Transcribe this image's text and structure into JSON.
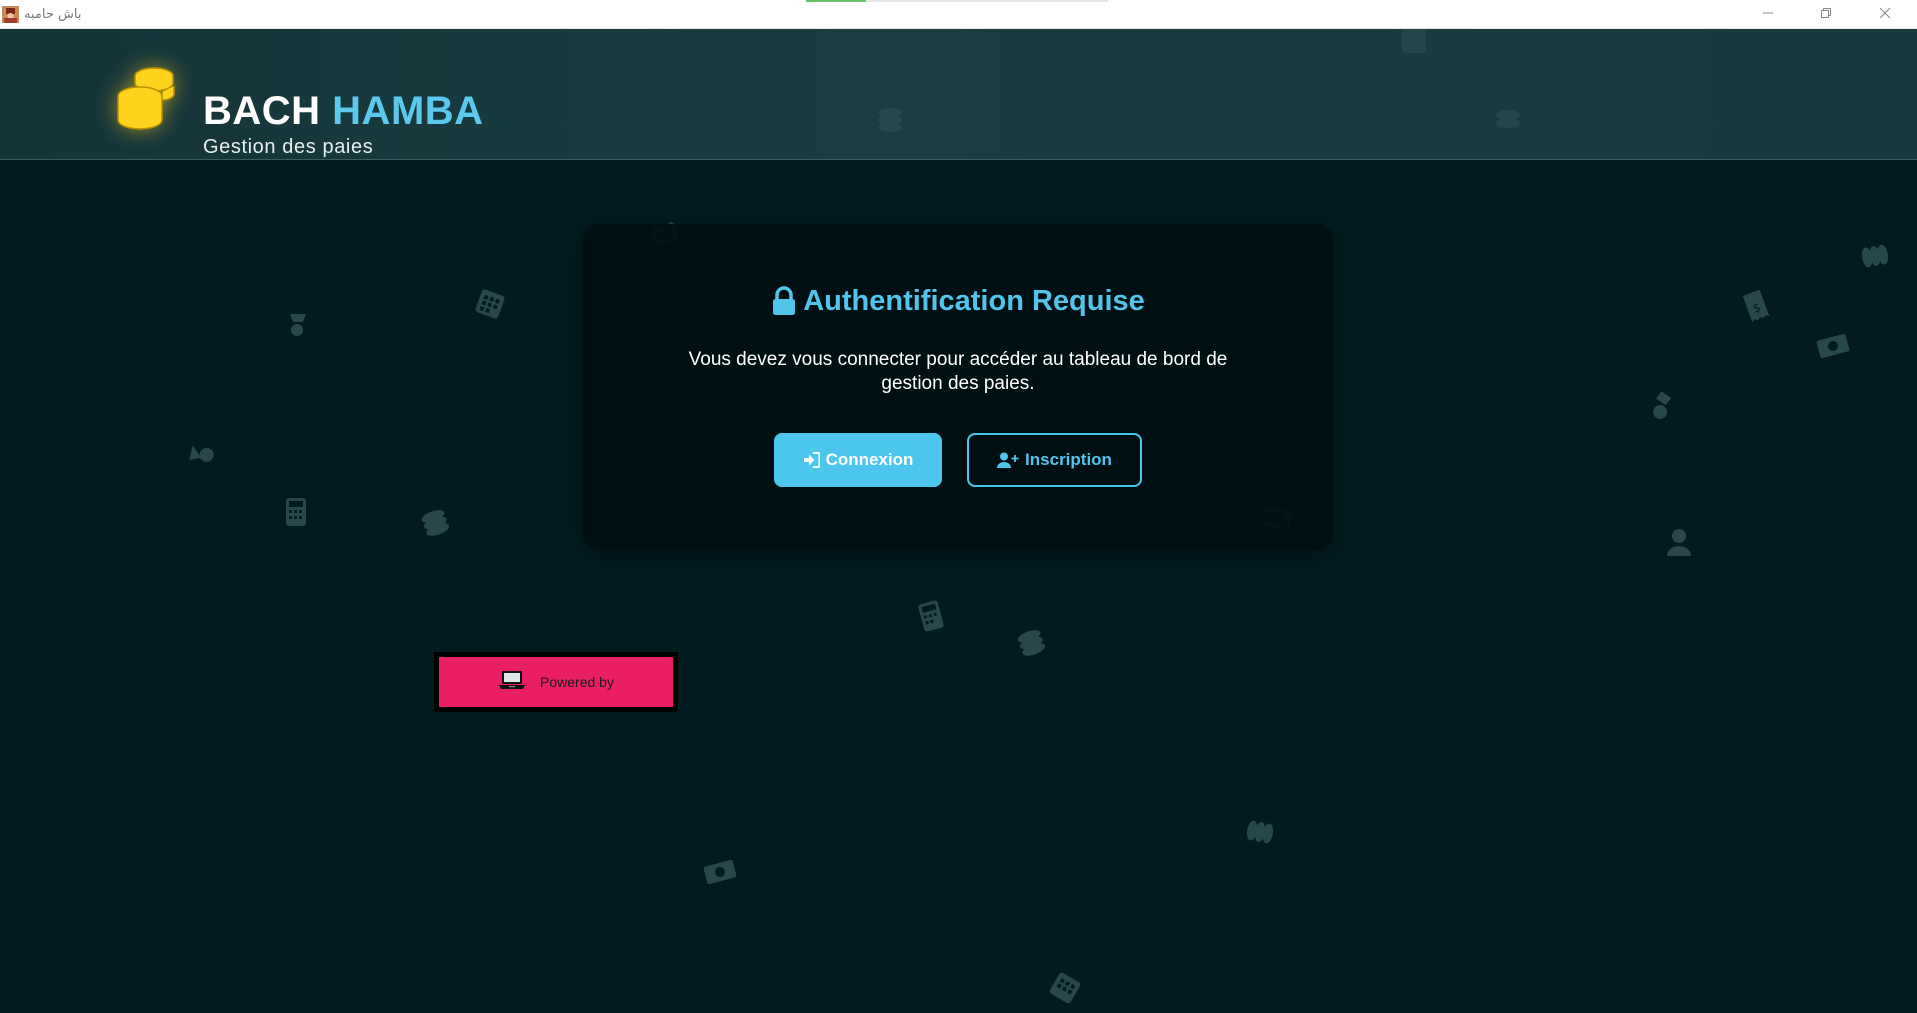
{
  "window": {
    "title": "باش حامبه",
    "app_icon": "app-logo-icon",
    "controls": [
      "minimize-icon",
      "restore-icon",
      "close-icon"
    ],
    "loading_progress": 0.2
  },
  "header": {
    "logo_icon": "coins-icon",
    "brand_part1": "BACH",
    "brand_part2": "HAMBA",
    "subtitle": "Gestion des paies"
  },
  "auth": {
    "icon": "lock-icon",
    "title": "Authentification Requise",
    "message": "Vous devez vous connecter pour accéder au tableau de bord de gestion des paies.",
    "login_icon": "sign-in-icon",
    "login_label": "Connexion",
    "register_icon": "user-plus-icon",
    "register_label": "Inscription"
  },
  "powered": {
    "icon": "laptop-icon",
    "label": "Powered by"
  },
  "background_icons": [
    "coins-icon",
    "calculator-icon",
    "user-icon",
    "money-bill-icon",
    "receipt-icon",
    "users-icon"
  ],
  "colors": {
    "background": "#011b1f",
    "header": "#1b3d41",
    "accent": "#4cc6ec",
    "card": "#000e10",
    "coin_gold": "#ffd21e",
    "badge": "#e91e63"
  }
}
